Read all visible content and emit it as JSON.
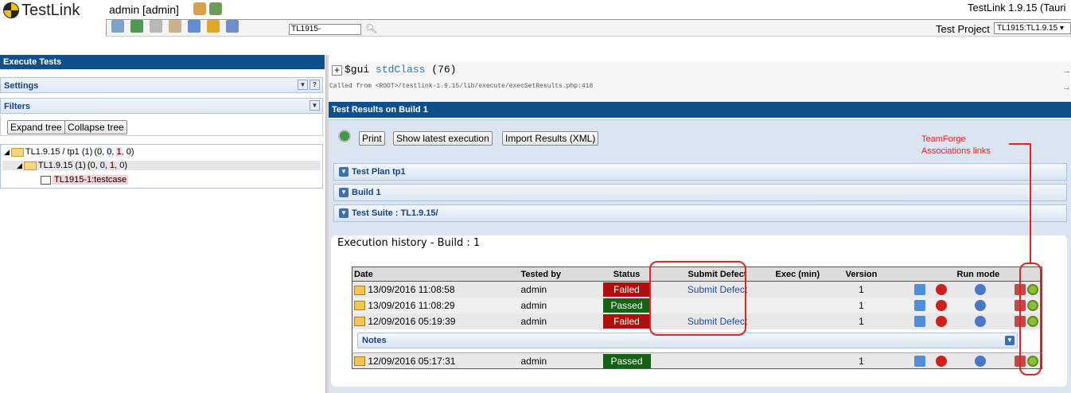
{
  "app": {
    "logo_text": "TestLink",
    "user": "admin [admin]",
    "version": "TestLink 1.9.15 (Tauri"
  },
  "header": {
    "search_value": "TL1915-",
    "project_label": "Test Project",
    "project_value": "TL1915:TL1.9.15"
  },
  "left": {
    "title": "Execute Tests",
    "settings": "Settings",
    "filters": "Filters",
    "expand_tree": "Expand tree",
    "collapse_tree": "Collapse tree",
    "tree": [
      {
        "label": "TL1.9.15 / tp1 (1)",
        "counts": [
          "0",
          "0",
          "1",
          "0"
        ]
      },
      {
        "label": "TL1.9.15 (1)",
        "counts": [
          "0",
          "0",
          "1",
          "0"
        ]
      },
      {
        "label": "TL1915-1:testcase"
      }
    ]
  },
  "right": {
    "gui_var": "$gui",
    "gui_class": "stdClass",
    "gui_count": "(76)",
    "called_from": "Called from <ROOT>/testlink-1.9.15/lib/execute/execSetResults.php:418",
    "arrow": "→",
    "title": "Test Results on Build 1",
    "print": "Print",
    "show_latest": "Show latest execution",
    "import_results": "Import Results (XML)",
    "sections": [
      "Test Plan tp1",
      "Build 1",
      "Test Suite : TL1.9.15/"
    ],
    "history_title": "Execution history - Build : 1",
    "annotation": "TeamForge\nAssociations links"
  },
  "table": {
    "headers": [
      "Date",
      "Tested by",
      "Status",
      "Submit Defect",
      "Exec (min)",
      "Version",
      "Run mode"
    ],
    "rows": [
      {
        "date": "13/09/2016 11:08:58",
        "tester": "admin",
        "status": "Failed",
        "defect": "Submit Defect",
        "version": "1"
      },
      {
        "date": "13/09/2016 11:08:29",
        "tester": "admin",
        "status": "Passed",
        "defect": "",
        "version": "1"
      },
      {
        "date": "12/09/2016 05:19:39",
        "tester": "admin",
        "status": "Failed",
        "defect": "Submit Defect",
        "version": "1"
      },
      {
        "date": "12/09/2016 05:17:31",
        "tester": "admin",
        "status": "Passed",
        "defect": "",
        "version": "1"
      }
    ],
    "notes_label": "Notes"
  },
  "colors": {
    "accent": "#0f4f8c",
    "failed": "#b10d0d",
    "passed": "#146214",
    "annotation": "#e0231c"
  }
}
